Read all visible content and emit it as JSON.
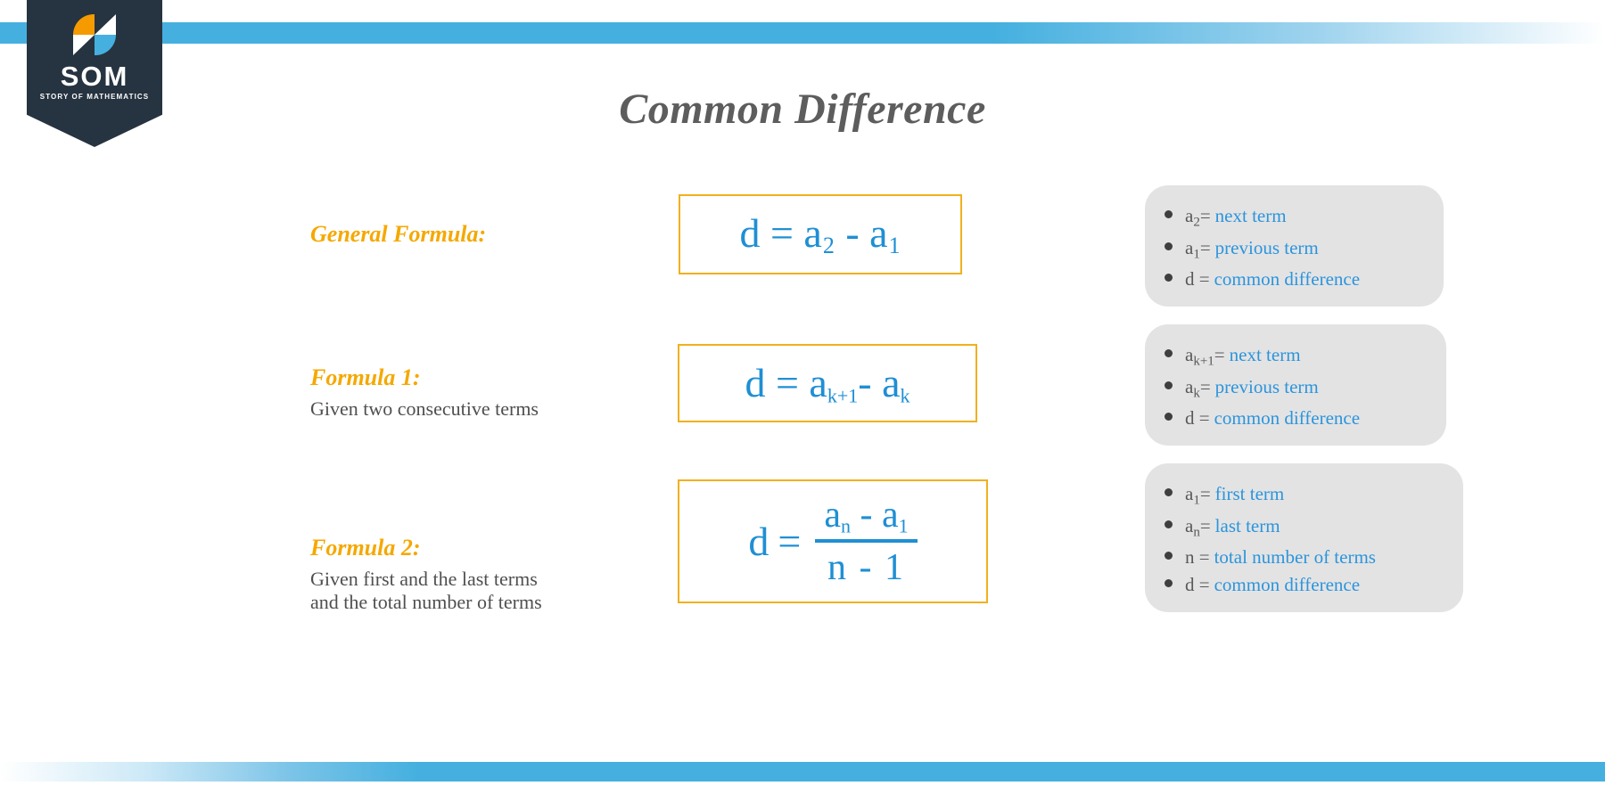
{
  "brand": {
    "name": "SOM",
    "tagline": "STORY OF MATHEMATICS",
    "colors": {
      "navy": "#263340",
      "orange": "#f59b00",
      "blue": "#45b0df",
      "white": "#ffffff"
    }
  },
  "theme": {
    "title_color": "#5d5d5d",
    "label_color": "#f5a800",
    "formula_color": "#1f8fd4",
    "formula_border": "#f2b01e",
    "legend_background": "#e4e3e3",
    "legend_symbol_color": "#595959",
    "legend_description_color": "#2a95dd",
    "band_color": "#45b0df"
  },
  "page_title": "Common Difference",
  "rows": [
    {
      "label": "General Formula:",
      "sublabel": "",
      "formula": {
        "kind": "inline",
        "lhs": "d",
        "equals": "=",
        "term1_base": "a",
        "term1_sub": "2",
        "operator": "-",
        "term2_base": "a",
        "term2_sub": "1",
        "plain": "d = a₂ - a₁"
      },
      "legend": [
        {
          "symbol_base": "a",
          "symbol_sub": "2",
          "equals": "=",
          "description": "next term"
        },
        {
          "symbol_base": "a",
          "symbol_sub": "1",
          "equals": "=",
          "description": "previous term"
        },
        {
          "symbol_base": "d",
          "symbol_sub": "",
          "equals": "=",
          "description": "common difference"
        }
      ]
    },
    {
      "label": "Formula 1:",
      "sublabel": "Given two consecutive terms",
      "formula": {
        "kind": "inline",
        "lhs": "d",
        "equals": "=",
        "term1_base": "a",
        "term1_sub": "k+1",
        "operator": "-",
        "term2_base": "a",
        "term2_sub": "k",
        "plain": "d = a(k+1) - a(k)"
      },
      "legend": [
        {
          "symbol_base": "a",
          "symbol_sub": "k+1",
          "equals": "=",
          "description": "next term"
        },
        {
          "symbol_base": "a",
          "symbol_sub": "k",
          "equals": "=",
          "description": "previous term"
        },
        {
          "symbol_base": "d",
          "symbol_sub": "",
          "equals": "=",
          "description": "common difference"
        }
      ]
    },
    {
      "label": "Formula 2:",
      "sublabel": "Given first and the last terms\nand the total number of terms",
      "sublabel_line1": "Given first and the last terms",
      "sublabel_line2": "and the total number of terms",
      "formula": {
        "kind": "fraction",
        "lhs": "d",
        "equals": "=",
        "numerator_term1_base": "a",
        "numerator_term1_sub": "n",
        "numerator_operator": "-",
        "numerator_term2_base": "a",
        "numerator_term2_sub": "1",
        "denominator": "n - 1",
        "plain": "d = (aₙ - a₁) / (n - 1)"
      },
      "legend": [
        {
          "symbol_base": "a",
          "symbol_sub": "1",
          "equals": "=",
          "description": "first term"
        },
        {
          "symbol_base": "a",
          "symbol_sub": "n",
          "equals": "=",
          "description": "last term"
        },
        {
          "symbol_base": "n",
          "symbol_sub": "",
          "equals": "=",
          "description": "total number of terms"
        },
        {
          "symbol_base": "d",
          "symbol_sub": "",
          "equals": "=",
          "description": "common difference"
        }
      ]
    }
  ]
}
